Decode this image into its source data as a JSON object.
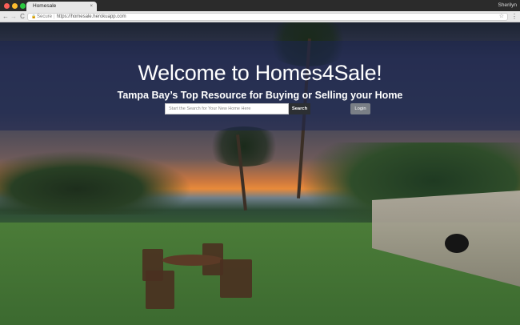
{
  "browser": {
    "tab_title": "Homesale",
    "tab_close": "×",
    "user_name": "Sherilyn",
    "back": "←",
    "forward": "→",
    "reload": "C",
    "secure_label": "Secure",
    "separator": "|",
    "url": "https://homesale.herokuapp.com",
    "bookmark_star": "☆",
    "menu": "⋮"
  },
  "hero": {
    "title": "Welcome to Homes4Sale!",
    "subtitle": "Tampa Bay’s Top Resource for Buying or Selling your Home",
    "search_placeholder": "Start the Search for Your New Home Here",
    "search_label": "Search",
    "login_label": "Login"
  },
  "colors": {
    "hero_band": "#1c2450",
    "search_button": "#2c2f33",
    "login_button": "#7a7f86"
  }
}
